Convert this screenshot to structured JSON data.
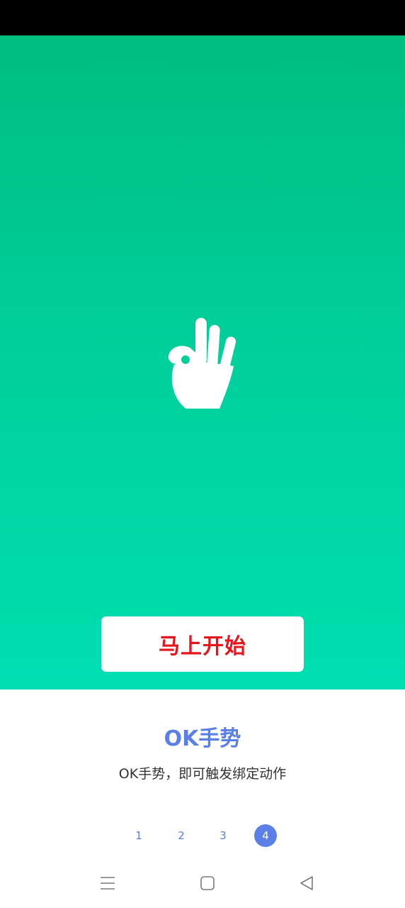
{
  "hero": {
    "icon": "ok-hand-icon",
    "start_label": "马上开始",
    "start_color": "#e8141b"
  },
  "gesture": {
    "title": "OK手势",
    "description": "OK手势，即可触发绑定动作",
    "accent": "#5a7fe6"
  },
  "pager": {
    "pages": [
      "1",
      "2",
      "3",
      "4"
    ],
    "active_index": 3
  },
  "navbar": {
    "menu_icon": "menu-icon",
    "home_icon": "home-square-icon",
    "back_icon": "back-triangle-icon"
  }
}
